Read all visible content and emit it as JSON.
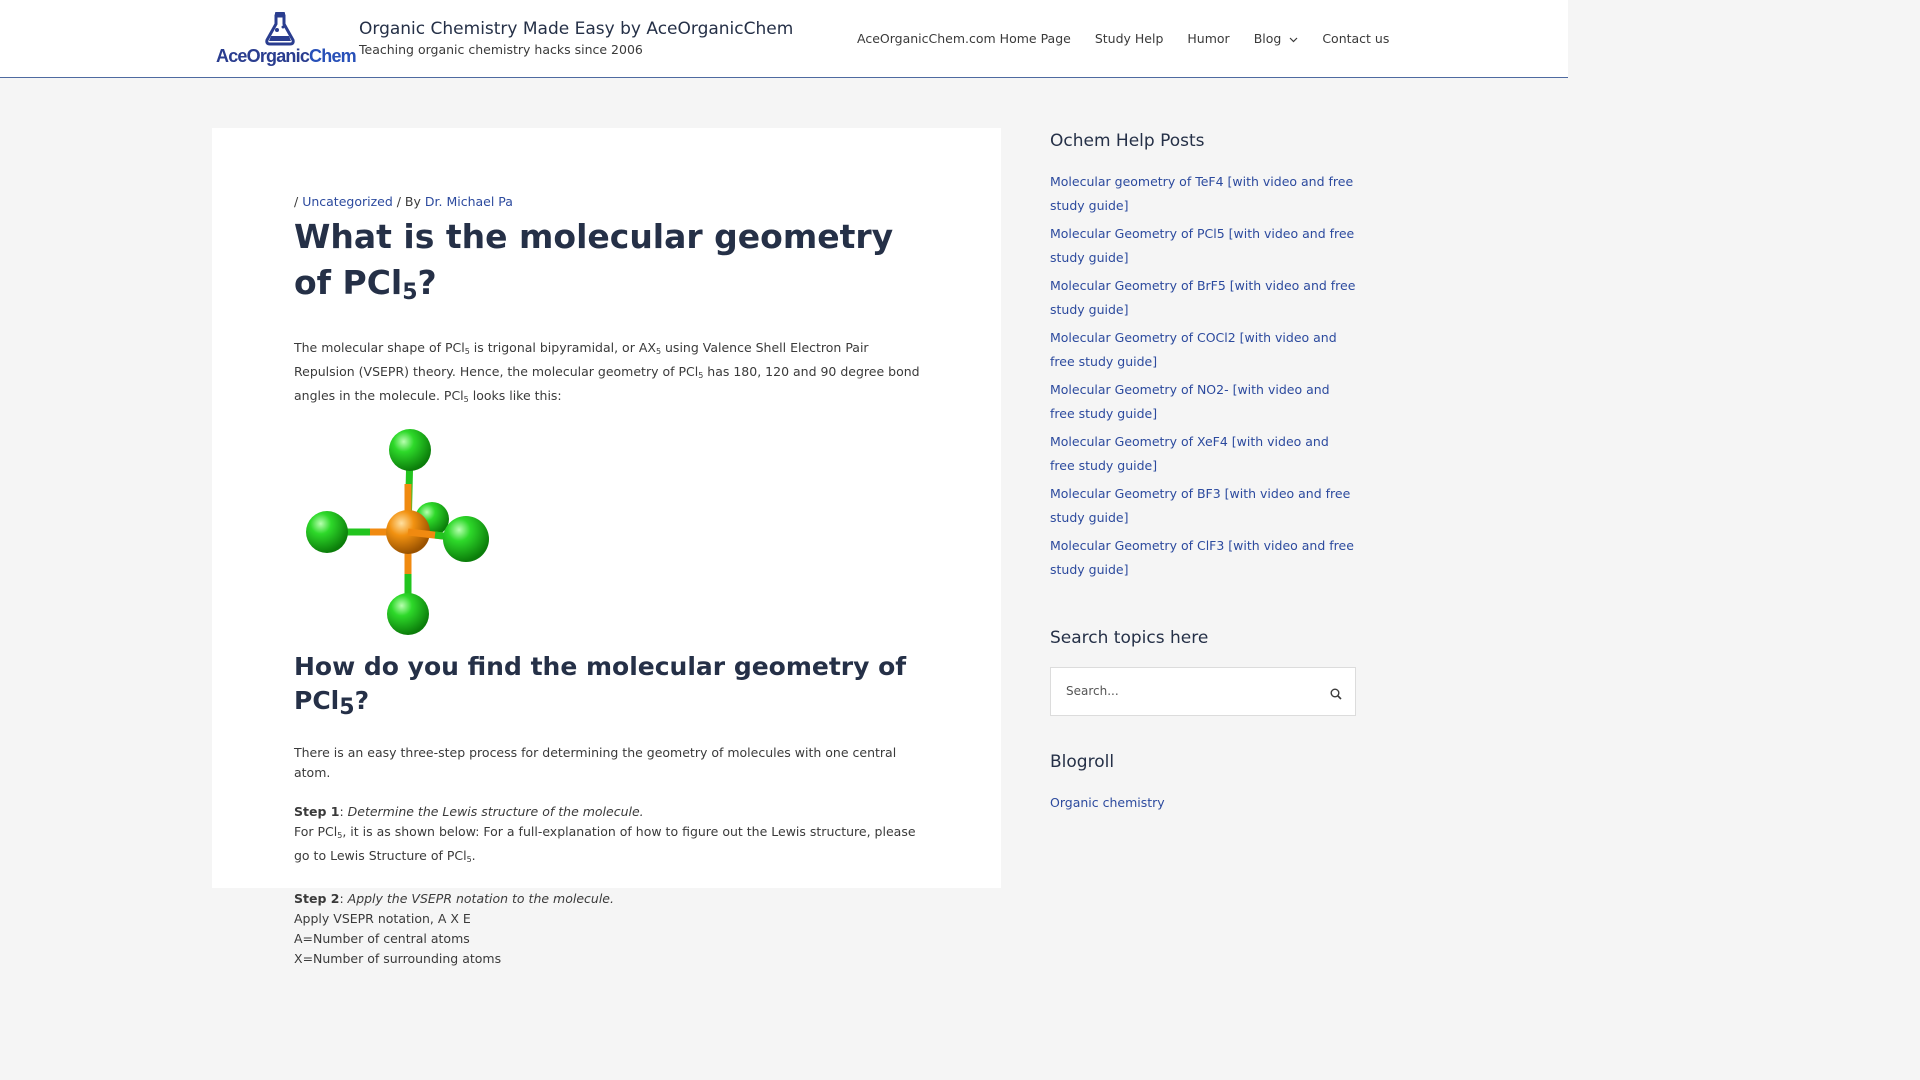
{
  "header": {
    "logo_text_1": "AceOrganic",
    "logo_text_2": "Chem",
    "site_title": "Organic Chemistry Made Easy by AceOrganicChem",
    "tagline": "Teaching organic chemistry hacks since 2006",
    "nav": [
      {
        "label": "AceOrganicChem.com Home Page"
      },
      {
        "label": "Study Help"
      },
      {
        "label": "Humor"
      },
      {
        "label": "Blog",
        "icon": "chevron-down-icon"
      },
      {
        "label": "Contact us"
      }
    ]
  },
  "post": {
    "meta_prefix": "/ ",
    "category": "Uncategorized",
    "by": " / By ",
    "author": "Dr. Michael Pa",
    "title_main": "What is the molecular geometry of PCl",
    "title_sub": "5",
    "title_end": "?",
    "intro": {
      "p1": "The molecular shape of PCl",
      "s1": "5",
      "p2": " is trigonal bipyramidal, or AX",
      "s2": "5",
      "p3": " using Valence Shell Electron Pair Repulsion (VSEPR) theory. Hence, the molecular geometry of PCl",
      "s3": "5",
      "p4": " has 180, 120 and 90 degree bond angles in the molecule. PCl",
      "s4": "5",
      "p5": " looks like this:"
    },
    "h2_main": "How do you find the molecular geometry of PCl",
    "h2_sub": "5",
    "h2_end": "?",
    "process_text": "There is an easy three-step process for determining the geometry of molecules with one central atom.",
    "step1_label": "Step 1",
    "step1_colon": ": ",
    "step1_text": "Determine the Lewis structure of the molecule.",
    "step1_body": {
      "p1": "For PCl",
      "s1": "5",
      "p2": ", it is as shown below: For a full-explanation of how to figure out the Lewis structure, please go to Lewis Structure of PCl",
      "s2": "5",
      "p3": "."
    },
    "step2_label": "Step 2",
    "step2_colon": ": ",
    "step2_text": "Apply the VSEPR notation to the molecule.",
    "step2_lines": [
      "Apply VSEPR notation, A X E",
      "A=Number of central atoms",
      "X=Number of surrounding atoms"
    ]
  },
  "sidebar": {
    "posts_title": "Ochem Help Posts",
    "posts": [
      "Molecular geometry of TeF4 [with video and free study guide]",
      "Molecular Geometry of PCl5 [with video and free study guide]",
      "Molecular Geometry of BrF5 [with video and free study guide]",
      "Molecular Geometry of COCl2 [with video and free study guide]",
      "Molecular Geometry of NO2- [with video and free study guide]",
      "Molecular Geometry of XeF4 [with video and free study guide]",
      "Molecular Geometry of BF3 [with video and free study guide]",
      "Molecular Geometry of ClF3 [with video and free study guide]"
    ],
    "search_title": "Search topics here",
    "search_placeholder": "Search...",
    "search_icon": "search-icon",
    "blogroll_title": "Blogroll",
    "blogroll_link": "Organic chemistry"
  },
  "colors": {
    "link": "#2c4a9e",
    "heading": "#253047",
    "chlorine": "#22c41e",
    "phosphorus": "#f08a10",
    "header_border": "#4e6aa0"
  }
}
